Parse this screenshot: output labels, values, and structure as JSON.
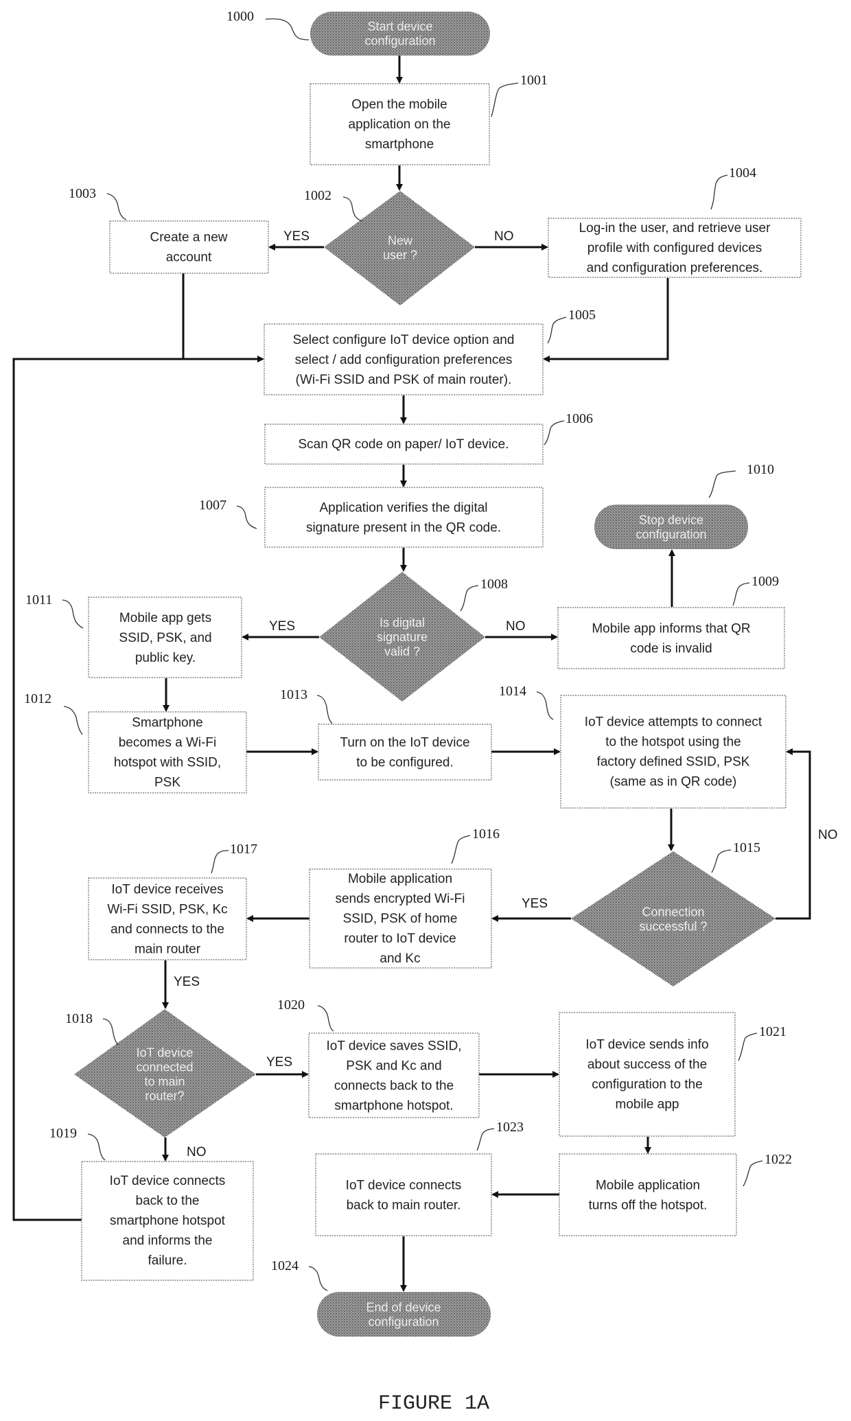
{
  "figure_caption": "FIGURE 1A",
  "colors": {
    "shape_fill": "#8c8c8c",
    "line": "#111111",
    "box_border": "#6a6a6a",
    "text": "#222222"
  },
  "nodes": {
    "n1000": {
      "ref": "1000",
      "type": "terminal",
      "lines": [
        "Start device",
        "configuration"
      ]
    },
    "n1001": {
      "ref": "1001",
      "type": "process",
      "lines": [
        "Open the mobile",
        "application on the",
        "smartphone"
      ]
    },
    "n1002": {
      "ref": "1002",
      "type": "decision",
      "lines": [
        "New",
        "user ?"
      ]
    },
    "n1003": {
      "ref": "1003",
      "type": "process",
      "lines": [
        "Create a new",
        "account"
      ]
    },
    "n1004": {
      "ref": "1004",
      "type": "process",
      "lines": [
        "Log-in the user, and retrieve user",
        "profile with configured devices",
        "and configuration  preferences."
      ]
    },
    "n1005": {
      "ref": "1005",
      "type": "process",
      "lines": [
        "Select configure IoT device option and",
        "select / add configuration preferences",
        "(Wi-Fi SSID and PSK of main router)."
      ]
    },
    "n1006": {
      "ref": "1006",
      "type": "process",
      "lines": [
        "Scan QR code on paper/ IoT device."
      ]
    },
    "n1007": {
      "ref": "1007",
      "type": "process",
      "lines": [
        "Application verifies the digital",
        "signature present in the QR code."
      ]
    },
    "n1008": {
      "ref": "1008",
      "type": "decision",
      "lines": [
        "Is digital",
        "signature",
        "valid ?"
      ]
    },
    "n1009": {
      "ref": "1009",
      "type": "process",
      "lines": [
        "Mobile app informs that QR",
        "code is invalid"
      ]
    },
    "n1010": {
      "ref": "1010",
      "type": "terminal",
      "lines": [
        "Stop device",
        "configuration"
      ]
    },
    "n1011": {
      "ref": "1011",
      "type": "process",
      "lines": [
        "Mobile app gets",
        "SSID, PSK, and",
        "public key."
      ]
    },
    "n1012": {
      "ref": "1012",
      "type": "process",
      "lines": [
        "Smartphone",
        "becomes a Wi-Fi",
        "hotspot with SSID,",
        "PSK"
      ]
    },
    "n1013": {
      "ref": "1013",
      "type": "process",
      "lines": [
        "Turn on the IoT device",
        "to be configured."
      ]
    },
    "n1014": {
      "ref": "1014",
      "type": "process",
      "lines": [
        "IoT device attempts to connect",
        "to the hotspot using the",
        "factory defined SSID, PSK",
        "(same as in QR code)"
      ]
    },
    "n1015": {
      "ref": "1015",
      "type": "decision",
      "lines": [
        "Connection",
        "successful ?"
      ]
    },
    "n1016": {
      "ref": "1016",
      "type": "process",
      "lines": [
        "Mobile application",
        "sends encrypted Wi-Fi",
        "SSID, PSK of home",
        "router to IoT device",
        "and Kc"
      ]
    },
    "n1017": {
      "ref": "1017",
      "type": "process",
      "lines": [
        "IoT device receives",
        "Wi-Fi SSID, PSK, Kc",
        "and connects to the",
        "main router"
      ]
    },
    "n1018": {
      "ref": "1018",
      "type": "decision",
      "lines": [
        "IoT device",
        "connected",
        "to main",
        "router?"
      ]
    },
    "n1019": {
      "ref": "1019",
      "type": "process",
      "lines": [
        "IoT device connects",
        "back to the",
        "smartphone  hotspot",
        "and informs the",
        "failure."
      ]
    },
    "n1020": {
      "ref": "1020",
      "type": "process",
      "lines": [
        "IoT device saves SSID,",
        "PSK and Kc and",
        "connects back to the",
        "smartphone  hotspot."
      ]
    },
    "n1021": {
      "ref": "1021",
      "type": "process",
      "lines": [
        "IoT device sends info",
        "about success of the",
        "configuration  to the",
        "mobile app"
      ]
    },
    "n1022": {
      "ref": "1022",
      "type": "process",
      "lines": [
        "Mobile application",
        "turns off the hotspot."
      ]
    },
    "n1023": {
      "ref": "1023",
      "type": "process",
      "lines": [
        "IoT device connects",
        "back to main router."
      ]
    },
    "n1024": {
      "ref": "1024",
      "type": "terminal",
      "lines": [
        "End of device",
        "configuration"
      ]
    }
  },
  "edge_labels": {
    "e1002_yes": "YES",
    "e1002_no": "NO",
    "e1008_yes": "YES",
    "e1008_no": "NO",
    "e1015_yes": "YES",
    "e1015_no": "NO",
    "e1017_yes": "YES",
    "e1018_yes": "YES",
    "e1018_no": "NO"
  }
}
